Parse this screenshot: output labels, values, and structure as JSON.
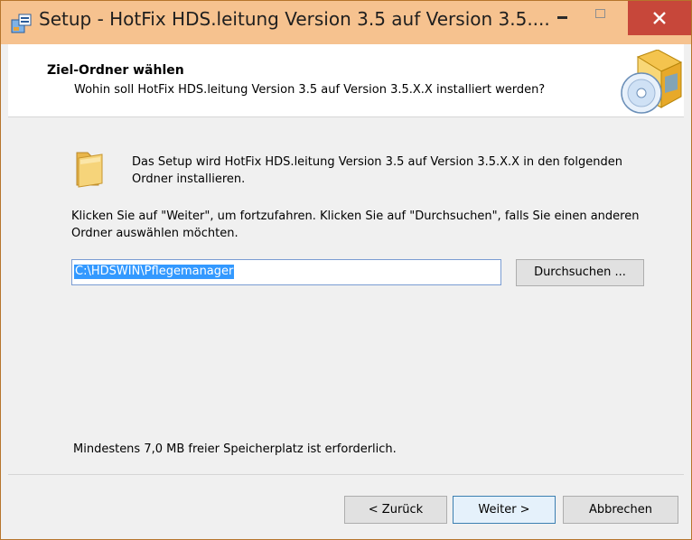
{
  "window": {
    "title": "Setup - HotFix HDS.leitung Version 3.5 auf Version 3.5....",
    "app_icon": "setup-package-icon",
    "controls": {
      "minimize": "minimize-icon",
      "maximize": "maximize-icon",
      "close": "close-icon"
    }
  },
  "header": {
    "title": "Ziel-Ordner wählen",
    "subtitle": "Wohin soll HotFix HDS.leitung Version 3.5 auf Version 3.5.X.X installiert werden?",
    "graphic": "installer-box-disc-icon"
  },
  "content": {
    "folder_icon": "folder-icon",
    "intro": "Das Setup wird HotFix HDS.leitung Version 3.5 auf Version 3.5.X.X in den folgenden Ordner installieren.",
    "instructions": "Klicken Sie auf \"Weiter\", um fortzufahren. Klicken Sie auf \"Durchsuchen\", falls Sie einen anderen Ordner auswählen möchten.",
    "path_value": "C:\\HDSWIN\\Pflegemanager",
    "browse_label": "Durchsuchen ...",
    "space_note": "Mindestens 7,0 MB freier Speicherplatz ist erforderlich."
  },
  "footer": {
    "back_label": "< Zurück",
    "next_label": "Weiter >",
    "cancel_label": "Abbrechen"
  },
  "colors": {
    "titlebar": "#f6c28f",
    "close_button": "#c7473a",
    "selection": "#3399ff",
    "default_button_border": "#3c7fb1"
  }
}
